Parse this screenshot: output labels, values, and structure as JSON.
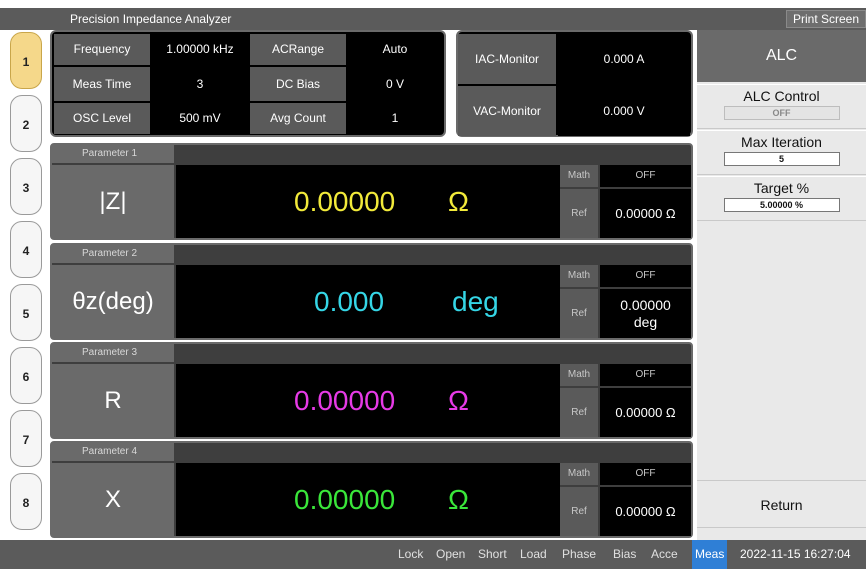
{
  "app": {
    "title": "Precision Impedance Analyzer",
    "print_label": "Print Screen"
  },
  "left_tabs": [
    "1",
    "2",
    "3",
    "4",
    "5",
    "6",
    "7",
    "8"
  ],
  "settings": {
    "frequency_label": "Frequency",
    "frequency_value": "1.00000 kHz",
    "acrange_label": "ACRange",
    "acrange_value": "Auto",
    "meastime_label": "Meas Time",
    "meastime_value": "3",
    "dcbias_label": "DC Bias",
    "dcbias_value": "0 V",
    "osclevel_label": "OSC Level",
    "osclevel_value": "500 mV",
    "avgcount_label": "Avg Count",
    "avgcount_value": "1"
  },
  "monitor": {
    "iac_label": "IAC-Monitor",
    "iac_value": "0.000 A",
    "vac_label": "VAC-Monitor",
    "vac_value": "0.000 V"
  },
  "params": [
    {
      "title": "Parameter 1",
      "name": "|Z|",
      "value": "0.00000",
      "unit": "Ω",
      "color": "#f2ea3a",
      "math_label": "Math",
      "math_value": "OFF",
      "ref_label": "Ref",
      "ref_value": "0.00000 Ω"
    },
    {
      "title": "Parameter 2",
      "name": "θz(deg)",
      "value": "0.000",
      "unit": "deg",
      "color": "#35d6e6",
      "math_label": "Math",
      "math_value": "OFF",
      "ref_label": "Ref",
      "ref_value_line1": "0.00000",
      "ref_value_line2": "deg"
    },
    {
      "title": "Parameter 3",
      "name": "R",
      "value": "0.00000",
      "unit": "Ω",
      "color": "#e63ae6",
      "math_label": "Math",
      "math_value": "OFF",
      "ref_label": "Ref",
      "ref_value": "0.00000 Ω"
    },
    {
      "title": "Parameter 4",
      "name": "X",
      "value": "0.00000",
      "unit": "Ω",
      "color": "#3ae63a",
      "math_label": "Math",
      "math_value": "OFF",
      "ref_label": "Ref",
      "ref_value": "0.00000 Ω"
    }
  ],
  "right_panel": {
    "header": "ALC",
    "alc_control_label": "ALC Control",
    "alc_control_value": "OFF",
    "max_iteration_label": "Max Iteration",
    "max_iteration_value": "5",
    "target_label": "Target %",
    "target_value": "5.00000 %",
    "return_label": "Return"
  },
  "statusbar": {
    "items": [
      "Lock",
      "Open",
      "Short",
      "Load",
      "Phase",
      "Bias",
      "Acce"
    ],
    "active": "Meas",
    "datetime": "2022-11-15 16:27:04"
  }
}
